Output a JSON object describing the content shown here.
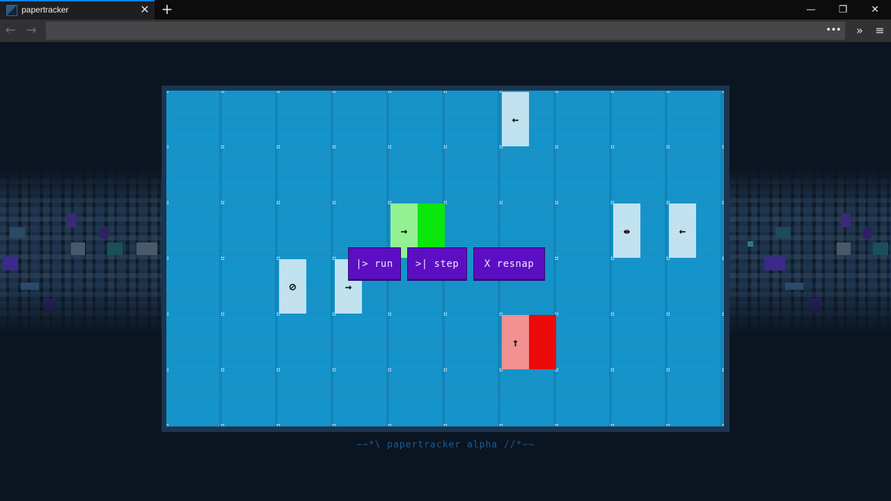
{
  "browser": {
    "tab_title": "papertracker",
    "tab_close": "✕",
    "new_tab": "+",
    "window_controls": {
      "minimize": "—",
      "restore": "❐",
      "close": "✕"
    },
    "back": "←",
    "forward": "→",
    "url": "",
    "page_actions": "•••",
    "overflow": "»",
    "menu": "≡"
  },
  "board": {
    "buttons": {
      "run": "|> run",
      "step": ">| step",
      "resnap": "X resnap"
    },
    "tiles": [
      {
        "id": "tile-left-arrow-top",
        "symbol": "←"
      },
      {
        "id": "tile-rotate-mid",
        "symbol": "⇹"
      },
      {
        "id": "tile-left-arrow-right",
        "symbol": "←"
      },
      {
        "id": "tile-blocked",
        "symbol": "⊘"
      },
      {
        "id": "tile-right-arrow-low",
        "symbol": "→"
      },
      {
        "id": "tile-start-green",
        "symbol": "→"
      },
      {
        "id": "tile-end-red",
        "symbol": "↑"
      }
    ]
  },
  "footer": "~~*\\ papertracker alpha //*~~",
  "colors": {
    "board_bg": "#1191c8",
    "frame": "#1b3550",
    "button": "#5c0fc2",
    "start_green": "#0be60b",
    "end_red": "#ec0a0a",
    "page_bg": "#0b1522"
  }
}
